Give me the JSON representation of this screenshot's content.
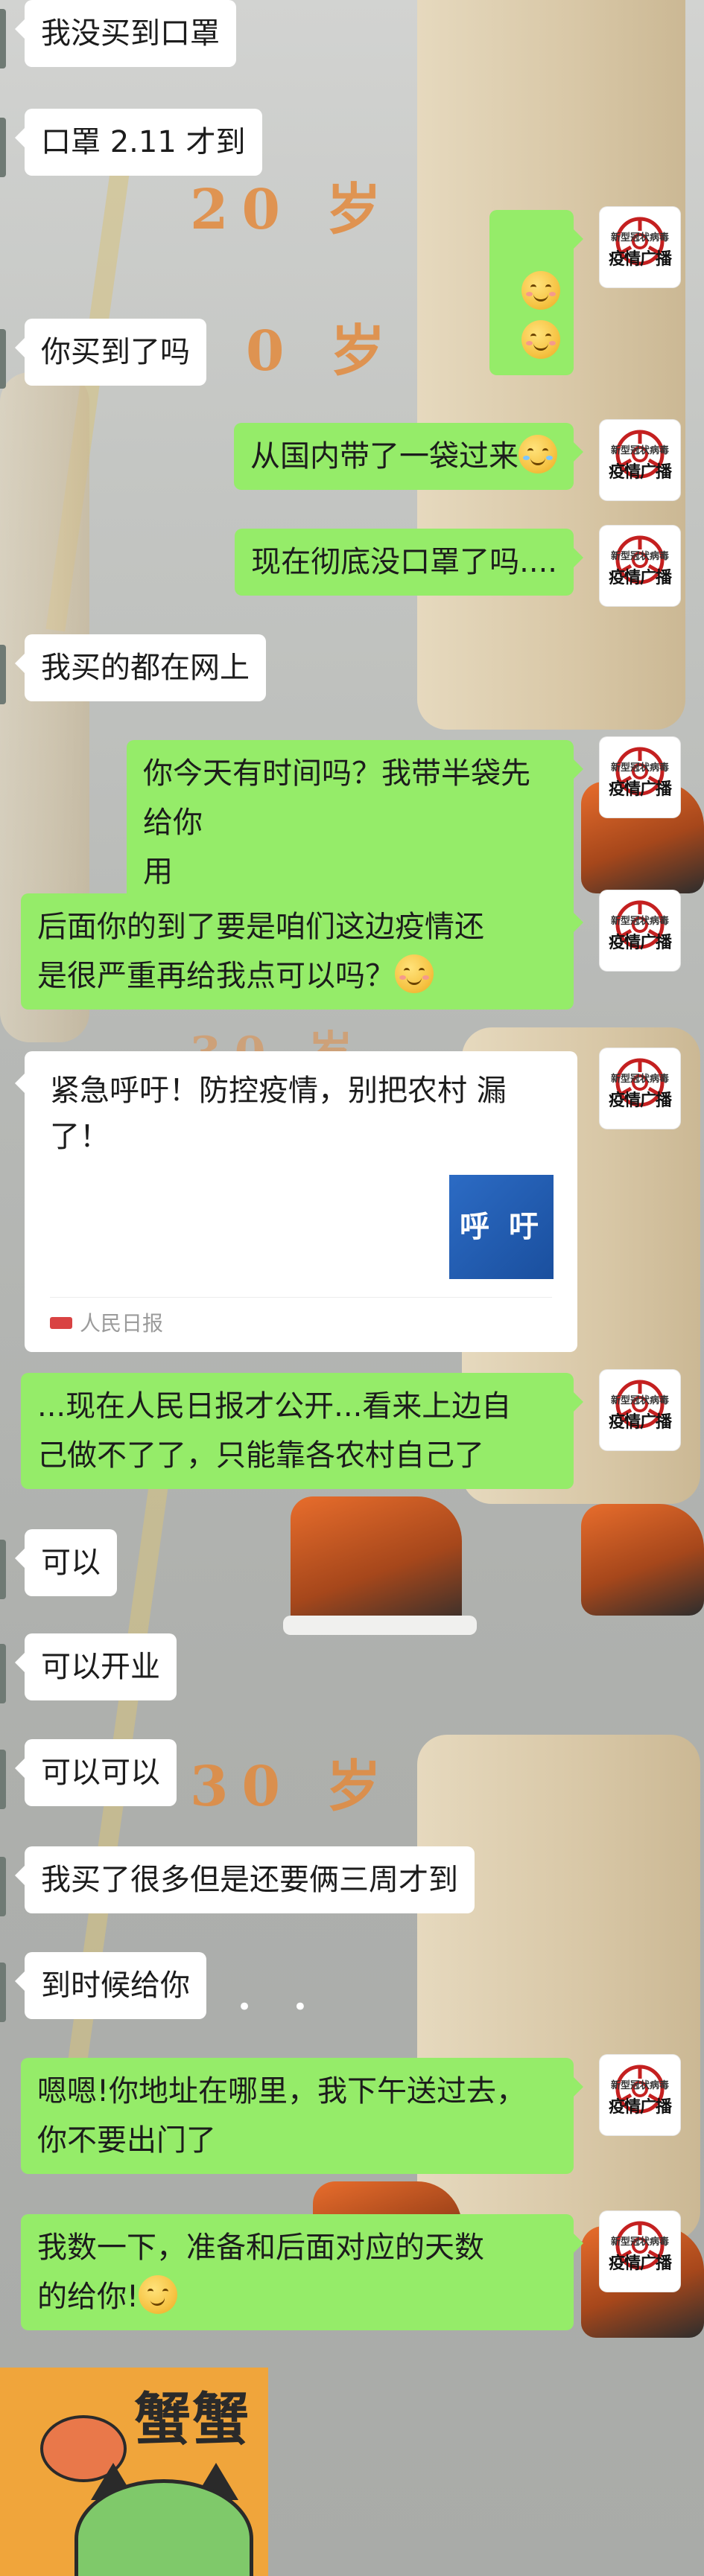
{
  "wallpaper": {
    "age_texts": [
      "20 岁",
      "0 岁",
      "30 岁",
      "30 岁"
    ]
  },
  "messages": [
    {
      "side": "in",
      "text": "我没买到口罩"
    },
    {
      "side": "in",
      "text": "口罩 2.11 才到"
    },
    {
      "side": "out",
      "emoji": [
        "slightly-smiling-face",
        "slightly-smiling-face"
      ]
    },
    {
      "side": "in",
      "text": "你买到了吗"
    },
    {
      "side": "out",
      "text": "从国内带了一袋过来",
      "emoji": [
        "laughing-crying-face"
      ]
    },
    {
      "side": "out",
      "text": "现在彻底没口罩了吗...."
    },
    {
      "side": "in",
      "text": "我买的都在网上"
    },
    {
      "side": "out",
      "text": "你今天有时间吗？我带半袋先给你\n用"
    },
    {
      "side": "out",
      "text": "后面你的到了要是咱们这边疫情还\n是很严重再给我点可以吗？",
      "emoji": [
        "slightly-smiling-face"
      ]
    },
    {
      "side": "out",
      "type": "article"
    },
    {
      "side": "out",
      "text": "...现在人民日报才公开...看来上边自\n己做不了了，只能靠各农村自己了"
    },
    {
      "side": "in",
      "text": "可以"
    },
    {
      "side": "in",
      "text": "可以开业"
    },
    {
      "side": "in",
      "text": "可以可以"
    },
    {
      "side": "in",
      "text": "我买了很多但是还要俩三周才到"
    },
    {
      "side": "in",
      "text": "到时候给你"
    },
    {
      "side": "out",
      "text": "嗯嗯!你地址在哪里，我下午送过去，\n你不要出门了"
    },
    {
      "side": "out",
      "text": "我数一下，准备和后面对应的天数\n的给你!",
      "emoji": [
        "smirking-face"
      ]
    },
    {
      "side": "in",
      "type": "sticker"
    }
  ],
  "article": {
    "title": "紧急呼吁！防控疫情，别把农村\n漏了！",
    "thumb_text": "呼 吁",
    "source": "人民日报"
  },
  "avatar": {
    "line1": "新型冠状病毒",
    "line2": "疫情广播",
    "icon": "biohazard-icon"
  },
  "typing_indicator": "• •",
  "sticker": {
    "text": "蟹蟹"
  },
  "colors": {
    "outgoing_bubble": "#95ec69",
    "incoming_bubble": "#ffffff",
    "avatar_symbol": "#c42020"
  }
}
